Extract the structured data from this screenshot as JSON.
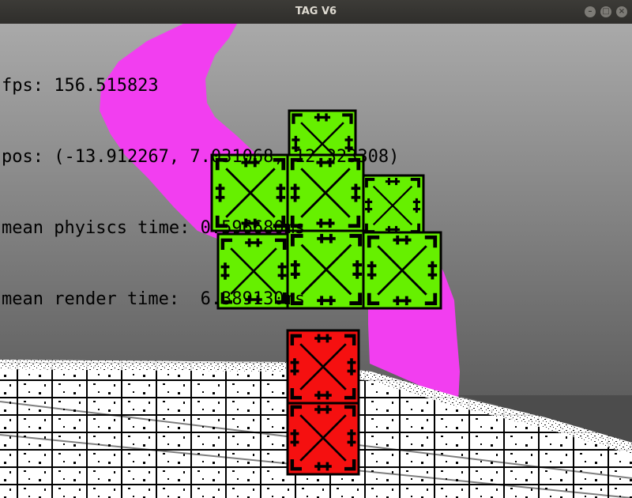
{
  "window": {
    "title": "TAG V6",
    "buttons": {
      "minimize_glyph": "–",
      "maximize_glyph": "□",
      "close_glyph": "×"
    }
  },
  "hud": {
    "fps": "fps: 156.515823",
    "pos": "pos: (-13.912267, 7.031068, 12.323308)",
    "physics": "mean phyiscs time: 0.596680ms",
    "render": "mean render time:  6.389130ms"
  },
  "colors": {
    "sky_top": "#a9a9a9",
    "sky_bottom": "#4a4a4a",
    "trail": "#f23ef0",
    "leaf_block": "#66f000",
    "trunk_block": "#f51010",
    "floor": "#ffffff",
    "block_marking": "#000000"
  }
}
